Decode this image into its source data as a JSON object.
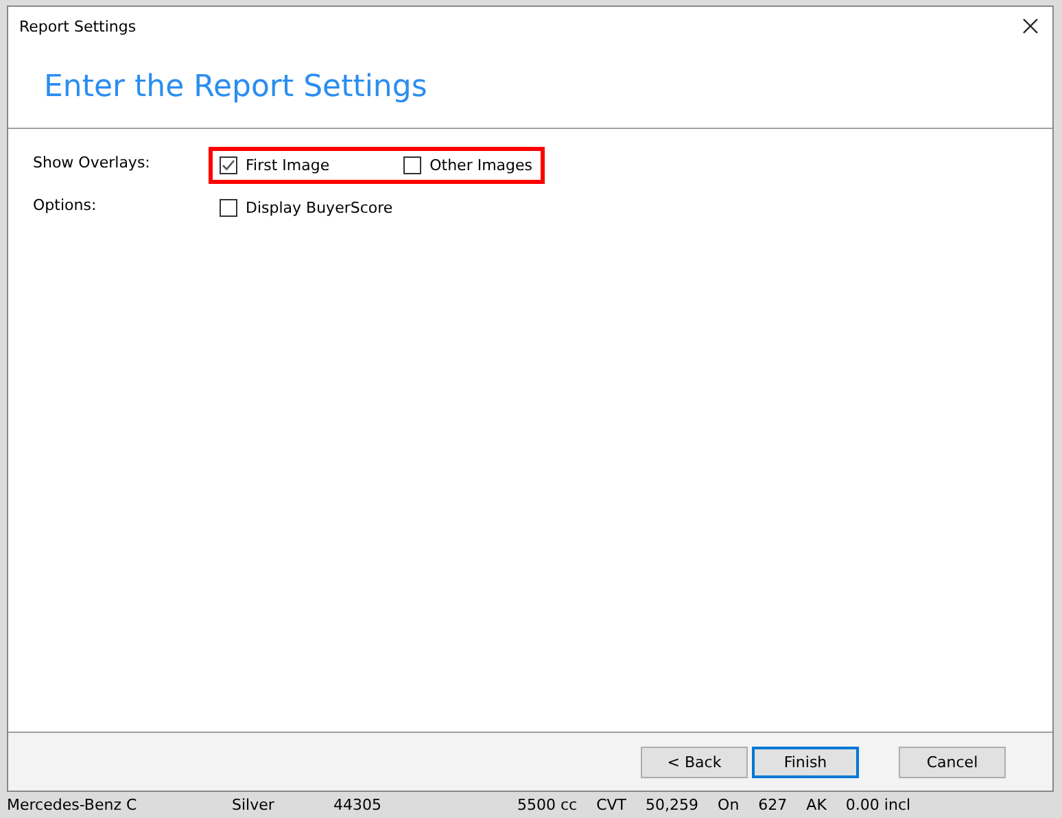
{
  "window": {
    "title": "Report Settings"
  },
  "heading": "Enter the Report Settings",
  "settings": [
    {
      "label": "Show Overlays:",
      "highlighted": true,
      "options": [
        {
          "label": "First Image",
          "checked": true
        },
        {
          "label": "Other Images",
          "checked": false
        }
      ]
    },
    {
      "label": "Options:",
      "highlighted": false,
      "options": [
        {
          "label": "Display BuyerScore",
          "checked": false
        }
      ]
    }
  ],
  "buttons": [
    {
      "label": "< Back",
      "selected": false
    },
    {
      "label": "Finish",
      "selected": true
    },
    {
      "label": "Cancel",
      "selected": false
    }
  ],
  "background_row": [
    "Mercedes-Benz C",
    "Silver",
    "44305",
    "5500 cc",
    "CVT",
    "50,259",
    "On",
    "627",
    "AK",
    "0.00 incl"
  ]
}
